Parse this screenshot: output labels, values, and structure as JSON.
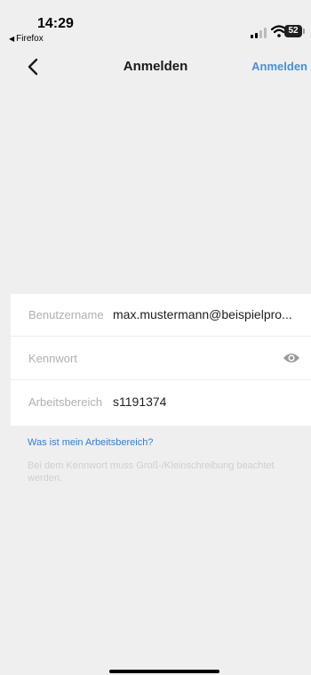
{
  "status_bar": {
    "time": "14:29",
    "back_app": "Firefox",
    "battery": "52",
    "icons": [
      "signal-icon",
      "wifi-icon",
      "battery-icon"
    ]
  },
  "nav": {
    "title": "Anmelden",
    "action_label": "Anmelden",
    "back_icon": "chevron-left-icon",
    "accent_color": "#4a8fd4"
  },
  "form": {
    "username": {
      "label": "Benutzername",
      "value": "max.mustermann@beispielpro..."
    },
    "password": {
      "label": "Kennwort",
      "value": "",
      "icon": "eye-icon"
    },
    "workspace": {
      "label": "Arbeitsbereich",
      "value": "s1191374"
    }
  },
  "help": {
    "link": "Was ist mein Arbeitsbereich?",
    "note": "Bei dem Kennwort muss Groß-/Kleinschreibung beachtet werden."
  }
}
